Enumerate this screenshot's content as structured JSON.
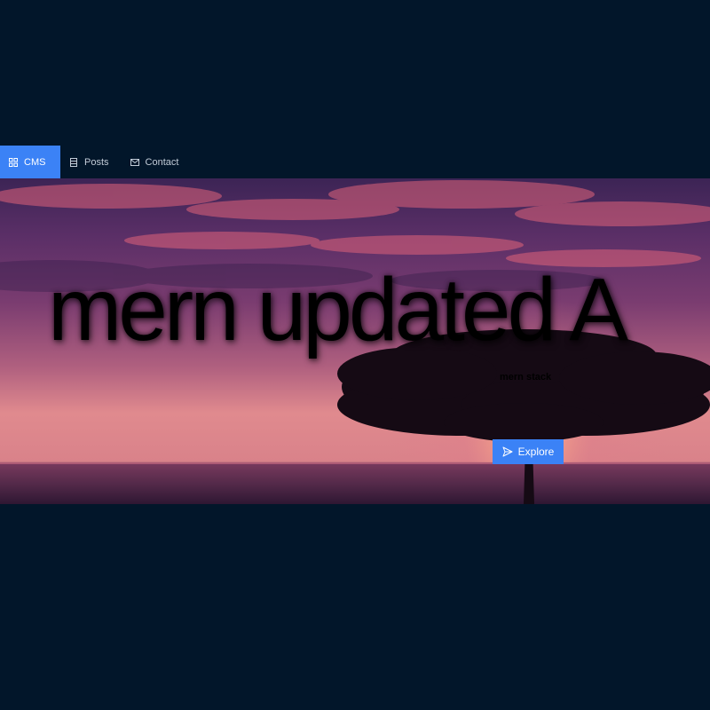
{
  "nav": {
    "items": [
      {
        "label": "CMS",
        "icon": "grid-icon",
        "active": true
      },
      {
        "label": "Posts",
        "icon": "document-icon",
        "active": false
      },
      {
        "label": "Contact",
        "icon": "mail-icon",
        "active": false
      }
    ]
  },
  "hero": {
    "title": "mern updated A",
    "subtitle": "mern stack",
    "button_label": "Explore",
    "button_icon": "send-icon"
  },
  "colors": {
    "background": "#02162a",
    "accent": "#3b82f6",
    "nav_text": "#c3ccd8"
  }
}
